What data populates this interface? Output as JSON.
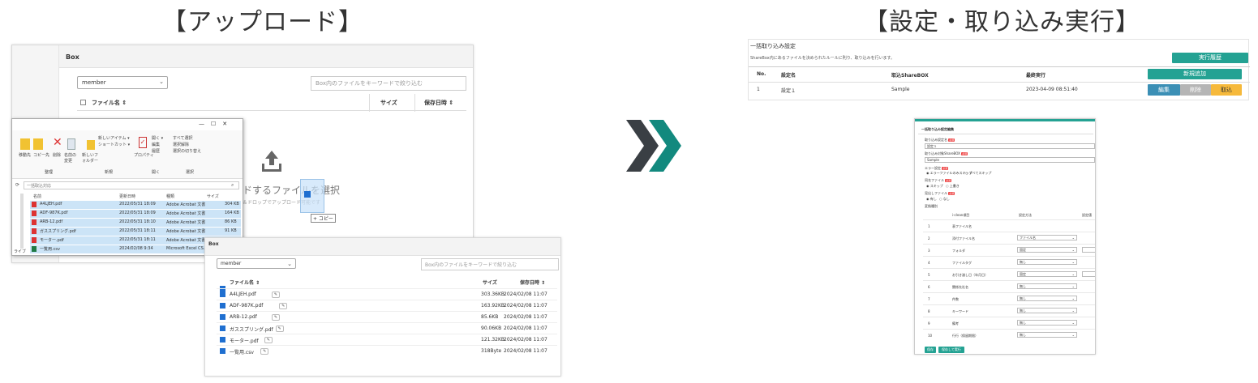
{
  "headings": {
    "upload": "【アップロード】",
    "settings": "【設定・取り込み実行】"
  },
  "box_back": {
    "bar_title": "Box",
    "folder": "member",
    "search_placeholder": "Box内のファイルをキーワードで絞り込む",
    "columns": {
      "name": "ファイル名 ⇕",
      "size": "サイズ",
      "date": "保存日時 ⇕"
    },
    "drop_text": "ードするファイルを選択",
    "drop_sub": "ック＆ドロップでアップロード可能です",
    "drag_badge": "+ コピー"
  },
  "explorer": {
    "window_controls": [
      "—",
      "☐",
      "✕"
    ],
    "ribbon_buttons": [
      "移動先",
      "コピー先",
      "削除",
      "名前の変更",
      "新しいフォルダー",
      "プロパティ"
    ],
    "ribbon_small": [
      "新しいアイテム ▾",
      "ショートカット ▾",
      "開く ▾",
      "編集",
      "履歴",
      "すべて選択",
      "選択解除",
      "選択の切り替え"
    ],
    "groups": [
      "整理",
      "新規",
      "開く",
      "選択"
    ],
    "search": "一括取込対応",
    "columns": [
      "名前",
      "更新日時",
      "種類",
      "サイズ"
    ],
    "files": [
      {
        "name": "A4LJEH.pdf",
        "date": "2022/05/31 18:09",
        "type": "Adobe Acrobat 文書",
        "size": "304 KB"
      },
      {
        "name": "ADF-987K.pdf",
        "date": "2022/05/31 18:09",
        "type": "Adobe Acrobat 文書",
        "size": "164 KB"
      },
      {
        "name": "ARB-12.pdf",
        "date": "2022/05/31 18:10",
        "type": "Adobe Acrobat 文書",
        "size": "86 KB"
      },
      {
        "name": "ガススプリング.pdf",
        "date": "2022/05/31 18:11",
        "type": "Adobe Acrobat 文書",
        "size": "91 KB"
      },
      {
        "name": "モーター.pdf",
        "date": "2022/05/31 18:11",
        "type": "Adobe Acrobat 文書",
        "size": "122 KB"
      },
      {
        "name": "一覧用.csv",
        "date": "2024/02/08 9:34",
        "type": "Microsoft Excel CS...",
        "size": "1 KB"
      }
    ],
    "status": "6 個の項目",
    "sidebar_status": "ライブ"
  },
  "box_front": {
    "bar_title": "Box",
    "folder": "member",
    "search_placeholder": "Box内のファイルをキーワードで絞り込む",
    "columns": {
      "name": "ファイル名 ⇕",
      "size": "サイズ",
      "date": "保存日時 ⇕"
    },
    "files": [
      {
        "name": "A4LJEH.pdf",
        "size": "303.36KB",
        "date": "2024/02/08 11:07"
      },
      {
        "name": "ADF-987K.pdf",
        "size": "163.92KB",
        "date": "2024/02/08 11:07"
      },
      {
        "name": "ARB-12.pdf",
        "size": "85.6KB",
        "date": "2024/02/08 11:07"
      },
      {
        "name": "ガススプリング.pdf",
        "size": "90.06KB",
        "date": "2024/02/08 11:07"
      },
      {
        "name": "モーター.pdf",
        "size": "121.32KB",
        "date": "2024/02/08 11:07"
      },
      {
        "name": "一覧用.csv",
        "size": "318Byte",
        "date": "2024/02/08 11:07"
      }
    ]
  },
  "settings": {
    "title": "一括取り込み設定",
    "desc": "ShareBox内にあるファイルを決められたルールに則り、取り込みを行います。",
    "execute_label": "実行履歴",
    "new_label": "新規追加",
    "columns": [
      "No.",
      "設定名",
      "取込ShareBOX",
      "最終実行"
    ],
    "row": {
      "no": "1",
      "name": "設定１",
      "box": "Sample",
      "last": "2023-04-09 08:51:40"
    },
    "row_buttons": {
      "edit": "編集",
      "delete": "削除",
      "import": "取込"
    }
  },
  "form": {
    "title": "一括取り込み設定編集",
    "fields": [
      {
        "label": "取り込み設定名",
        "value": "設定１"
      },
      {
        "label": "取り込み対象ShareBOX",
        "value": "Sample"
      }
    ],
    "error_label": "エラー設定",
    "error_options": [
      "エラーファイルのみスキップ",
      "すべてスキップ"
    ],
    "same_label": "同名ファイル",
    "same_options": [
      "スキップ",
      "上書き"
    ],
    "header_label": "見出しファイル",
    "header_options": [
      "有し",
      "なし"
    ],
    "mapping_label": "変換種別",
    "mapping_columns": [
      "",
      "i-clean項目",
      "設定方法",
      "設定値"
    ],
    "mapping_rows": [
      {
        "no": "1",
        "item": "表ファイル名",
        "method": ""
      },
      {
        "no": "2",
        "item": "添付ファイル名",
        "method": "ファイル名"
      },
      {
        "no": "3",
        "item": "フォルダ",
        "method": "固定"
      },
      {
        "no": "4",
        "item": "ファイルタグ",
        "method": "無し"
      },
      {
        "no": "5",
        "item": "お引き渡し日（年月日）",
        "method": "固定"
      },
      {
        "no": "6",
        "item": "関係先社名",
        "method": "無し"
      },
      {
        "no": "7",
        "item": "件数",
        "method": "無し"
      },
      {
        "no": "8",
        "item": "キーワード",
        "method": "無し"
      },
      {
        "no": "9",
        "item": "備考",
        "method": "無し"
      },
      {
        "no": "10",
        "item": "行行（保留期限）",
        "method": "無し"
      }
    ],
    "buttons": {
      "save": "保存",
      "save_exec": "保存して実行"
    }
  },
  "colors": {
    "teal": "#24a293",
    "arrow_dark": "#3a3f44",
    "arrow_teal": "#12897e",
    "select_blue": "#cce4f7",
    "import_yellow": "#f6b93b",
    "edit_blue": "#3b8fb5",
    "delete_gray": "#b5b5b5"
  }
}
